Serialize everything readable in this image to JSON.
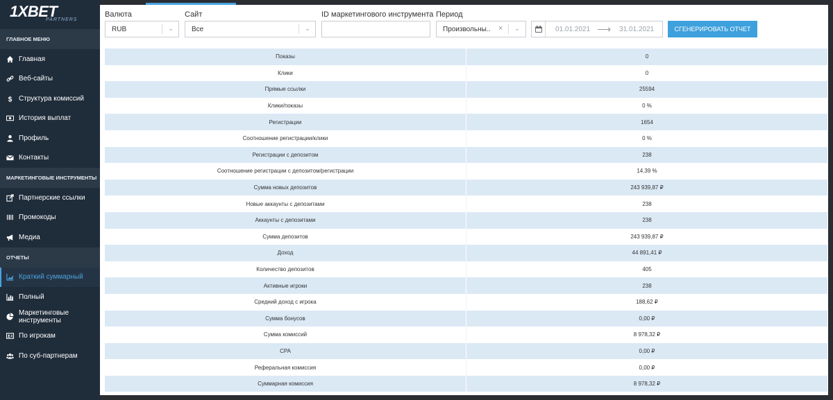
{
  "logo": {
    "main": "1XBET",
    "sub": "PARTNERS"
  },
  "sidebar": {
    "sections": [
      {
        "title": "ГЛАВНОЕ МЕНЮ"
      },
      {
        "title": "МАРКЕТИНГОВЫЕ ИНСТРУМЕНТЫ"
      },
      {
        "title": "ОТЧЕТЫ"
      }
    ],
    "main_items": [
      {
        "label": "Главная",
        "icon": "home-icon"
      },
      {
        "label": "Веб-сайты",
        "icon": "link-icon"
      },
      {
        "label": "Структура комиссий",
        "icon": "dollar-icon"
      },
      {
        "label": "История выплат",
        "icon": "money-icon"
      },
      {
        "label": "Профиль",
        "icon": "user-icon"
      },
      {
        "label": "Контакты",
        "icon": "envelope-icon"
      }
    ],
    "marketing_items": [
      {
        "label": "Партнерские ссылки",
        "icon": "external-link-icon"
      },
      {
        "label": "Промокоды",
        "icon": "barcode-icon"
      },
      {
        "label": "Медиа",
        "icon": "megaphone-icon"
      }
    ],
    "report_items": [
      {
        "label": "Краткий суммарный",
        "icon": "area-chart-icon",
        "active": true
      },
      {
        "label": "Полный",
        "icon": "bar-chart-icon"
      },
      {
        "label": "Маркетинговые инструменты",
        "icon": "pie-chart-icon"
      },
      {
        "label": "По игрокам",
        "icon": "id-card-icon"
      },
      {
        "label": "По суб-партнерам",
        "icon": "users-icon"
      }
    ]
  },
  "filters": {
    "currency": {
      "label": "Валюта",
      "value": "RUB"
    },
    "site": {
      "label": "Сайт",
      "value": "Все"
    },
    "marketing_id": {
      "label": "ID маркетингового инструмента",
      "value": ""
    },
    "period": {
      "label": "Период",
      "value": "Произвольны.."
    },
    "date_from": "01.01.2021",
    "date_to": "31.01.2021",
    "generate_label": "СГЕНЕРИРОВАТЬ ОТЧЕТ"
  },
  "accent_color": "#3ea0dc",
  "report_rows": [
    {
      "label": "Показы",
      "value": "0"
    },
    {
      "label": "Клики",
      "value": "0"
    },
    {
      "label": "Прямые ссылки",
      "value": "25594"
    },
    {
      "label": "Клики/показы",
      "value": "0 %"
    },
    {
      "label": "Регистрации",
      "value": "1654"
    },
    {
      "label": "Соотношение регистрации/клики",
      "value": "0 %"
    },
    {
      "label": "Регистрации с депозитом",
      "value": "238"
    },
    {
      "label": "Соотношение регистрации с депозитом/регистрации",
      "value": "14.39 %"
    },
    {
      "label": "Сумма новых депозитов",
      "value": "243 939,87 ₽"
    },
    {
      "label": "Новые аккаунты с депозитами",
      "value": "238"
    },
    {
      "label": "Аккаунты с депозитами",
      "value": "238"
    },
    {
      "label": "Сумма депозитов",
      "value": "243 939,87 ₽"
    },
    {
      "label": "Доход",
      "value": "44 891,41 ₽"
    },
    {
      "label": "Количество депозитов",
      "value": "405"
    },
    {
      "label": "Активные игроки",
      "value": "238"
    },
    {
      "label": "Средний доход с игрока",
      "value": "188,62 ₽"
    },
    {
      "label": "Сумма бонусов",
      "value": "0,00 ₽"
    },
    {
      "label": "Сумма комиссий",
      "value": "8 978,32 ₽"
    },
    {
      "label": "CPA",
      "value": "0,00 ₽"
    },
    {
      "label": "Реферальная комиссия",
      "value": "0,00 ₽"
    },
    {
      "label": "Суммарная комиссия",
      "value": "8 978,32 ₽"
    }
  ]
}
